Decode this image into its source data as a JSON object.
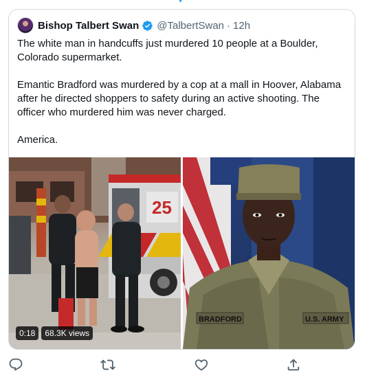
{
  "tweet": {
    "author": {
      "display_name": "Bishop Talbert Swan",
      "handle": "@TalbertSwan",
      "verified": true
    },
    "separator": "·",
    "timestamp": "12h",
    "paragraphs": [
      "The white man in handcuffs just murdered 10 people at a Boulder, Colorado supermarket.",
      "Emantic Bradford was murdered by a cop at a mall in Hoover, Alabama after he directed shoppers to safety during an active shooting. The officer who murdered him was never charged.",
      "America."
    ]
  },
  "media": {
    "video": {
      "duration": "0:18",
      "views": "68.3K views",
      "truck_number": "25"
    },
    "photo": {
      "name_tape": "BRADFORD",
      "branch_tape": "U.S. ARMY"
    }
  },
  "actions": {
    "icons": [
      "reply-icon",
      "retweet-icon",
      "like-icon",
      "share-icon"
    ]
  },
  "colors": {
    "accent": "#1d9bf0",
    "text": "#0f1419",
    "secondary": "#536471",
    "border": "#cfd9de",
    "icon": "#536471"
  }
}
